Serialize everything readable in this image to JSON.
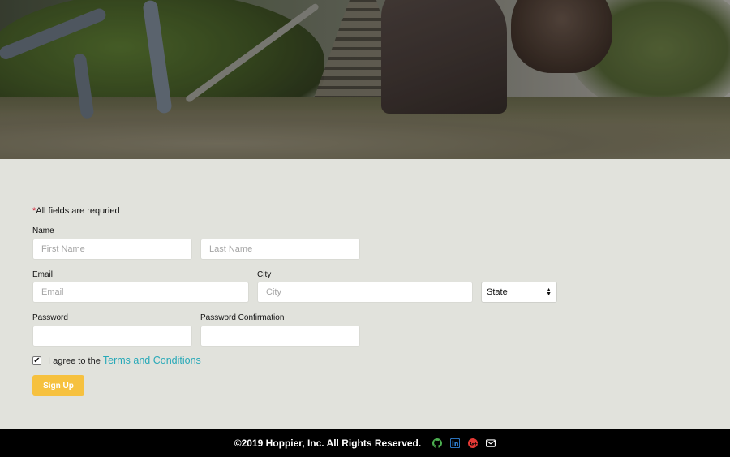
{
  "form": {
    "required_note_star": "*",
    "required_note": "All fields are requried",
    "name_label": "Name",
    "first_name_placeholder": "First Name",
    "last_name_placeholder": "Last Name",
    "email_label": "Email",
    "email_placeholder": "Email",
    "city_label": "City",
    "city_placeholder": "City",
    "state_selected": "State",
    "password_label": "Password",
    "password_confirmation_label": "Password Confirmation",
    "agree_text": "I agree to the",
    "terms_link": "Terms and Conditions",
    "agree_checked": true,
    "signup_label": "Sign Up"
  },
  "footer": {
    "copyright": "©2019 Hoppier, Inc. All Rights Reserved.",
    "icons": [
      "github-icon",
      "linkedin-icon",
      "google-plus-icon",
      "envelope-icon"
    ],
    "colors": {
      "github": "#4caf50",
      "linkedin": "#2f7fd1",
      "google_plus": "#e53935",
      "envelope": "#ffffff"
    }
  },
  "colors": {
    "accent": "#f6c13f",
    "link": "#28a9b8",
    "background": "#e1e2dc"
  }
}
